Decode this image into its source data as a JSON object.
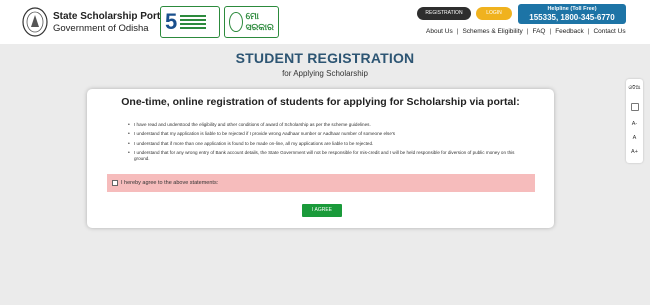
{
  "header": {
    "portal_title": "State Scholarship Portal",
    "portal_subtitle": "Government of Odisha",
    "badge2_text": "ମୋ ସରକାର",
    "registration_label": "REGISTRATION",
    "login_label": "LOGIN",
    "helpline_title": "Helpline (Toll Free)",
    "helpline_numbers": "155335, 1800-345-6770"
  },
  "nav": {
    "items": [
      "About Us",
      "Schemes & Eligibility",
      "FAQ",
      "Feedback",
      "Contact Us"
    ]
  },
  "page": {
    "title": "STUDENT REGISTRATION",
    "subtitle": "for Applying Scholarship"
  },
  "card": {
    "heading": "One-time, online registration of students for applying for Scholarship via portal:",
    "statements": [
      "I have read and understood the eligibility and other conditions of award of Scholarship as per the scheme guidelines.",
      "I understand that my application is liable to be rejected if I provide wrong Aadhaar number or Aadhaar number of someone else's",
      "I understand that if more than one application is found to be made on-line, all my applications are liable to be rejected.",
      "I understand that for any wrong entry of Bank account details, the State Government will not be responsible for mis-credit and I will be held responsible for diversion of public money on this ground."
    ],
    "agree_checkbox_label": "I hereby agree to the above statements:",
    "agree_button": "I AGREE"
  },
  "side_tools": {
    "odia": "ଓଡିଆ",
    "a_minus": "A-",
    "a_normal": "A",
    "a_plus": "A+"
  },
  "colors": {
    "accent": "#2d5573",
    "agree_button": "#1a9a3a",
    "agree_bar": "#f6bcbc",
    "helpline": "#1d74a6",
    "login": "#f0b21e"
  }
}
